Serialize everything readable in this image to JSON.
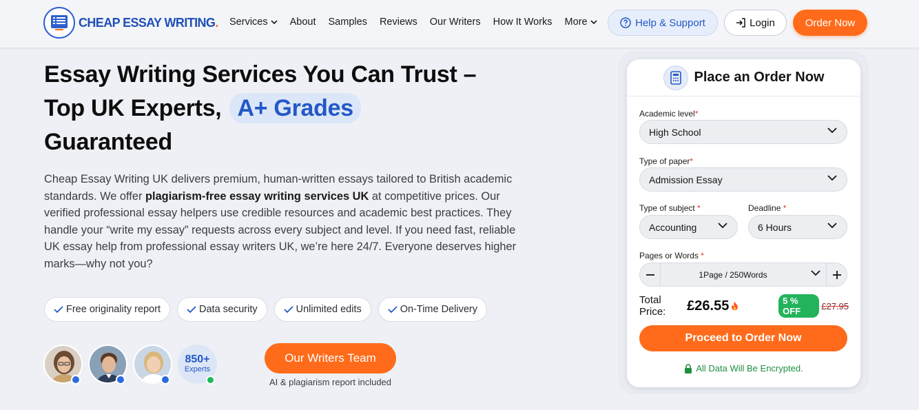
{
  "brand": {
    "name": "CHEAP ESSAY WRITING",
    "dot": ".",
    "accent": "#ff6b1a",
    "primary": "#2458c6"
  },
  "nav": {
    "items": [
      {
        "label": "Services",
        "has_dropdown": true
      },
      {
        "label": "About"
      },
      {
        "label": "Samples"
      },
      {
        "label": "Reviews"
      },
      {
        "label": "Our Writers"
      },
      {
        "label": "How It Works"
      },
      {
        "label": "More",
        "has_dropdown": true
      }
    ],
    "help_label": "Help & Support",
    "login_label": "Login",
    "order_label": "Order Now"
  },
  "hero": {
    "title_line1": "Essay Writing Services You Can Trust –",
    "title_line2": "Top UK Experts,",
    "title_highlight": "A+ Grades",
    "title_line3": "Guaranteed",
    "desc_part1": "Cheap Essay Writing UK delivers premium, human-written essays tailored to British academic standards. We offer ",
    "desc_bold": "plagiarism-free essay writing services UK",
    "desc_part2": " at competitive prices. Our verified professional essay helpers use credible resources and academic best practices. They handle your “write my essay” requests across every subject and level. If you need fast, reliable UK essay help from professional essay writers UK, we’re here 24/7. Everyone deserves higher marks—why not you?",
    "features": [
      "Free originality report",
      "Data security",
      "Unlimited edits",
      "On-Time Delivery"
    ],
    "experts_count": "850+",
    "experts_label": "Experts",
    "writers_button": "Our Writers Team",
    "writers_note": "AI & plagiarism report included"
  },
  "order_form": {
    "title": "Place an Order Now",
    "academic_level_label": "Academic level",
    "academic_level_value": "High School",
    "paper_type_label": "Type of paper",
    "paper_type_value": "Admission Essay",
    "subject_label": "Type of subject ",
    "subject_value": "Accounting",
    "deadline_label": "Deadline ",
    "deadline_value": "6 Hours",
    "pages_label": "Pages or Words ",
    "pages_value": "1Page / 250Words",
    "required_mark": "*",
    "total_label": "Total Price:",
    "total_value": "£26.55",
    "discount": "5 % OFF",
    "old_price": "£27.95",
    "proceed_label": "Proceed to Order Now",
    "secure_note": "All Data Will Be Encrypted."
  }
}
